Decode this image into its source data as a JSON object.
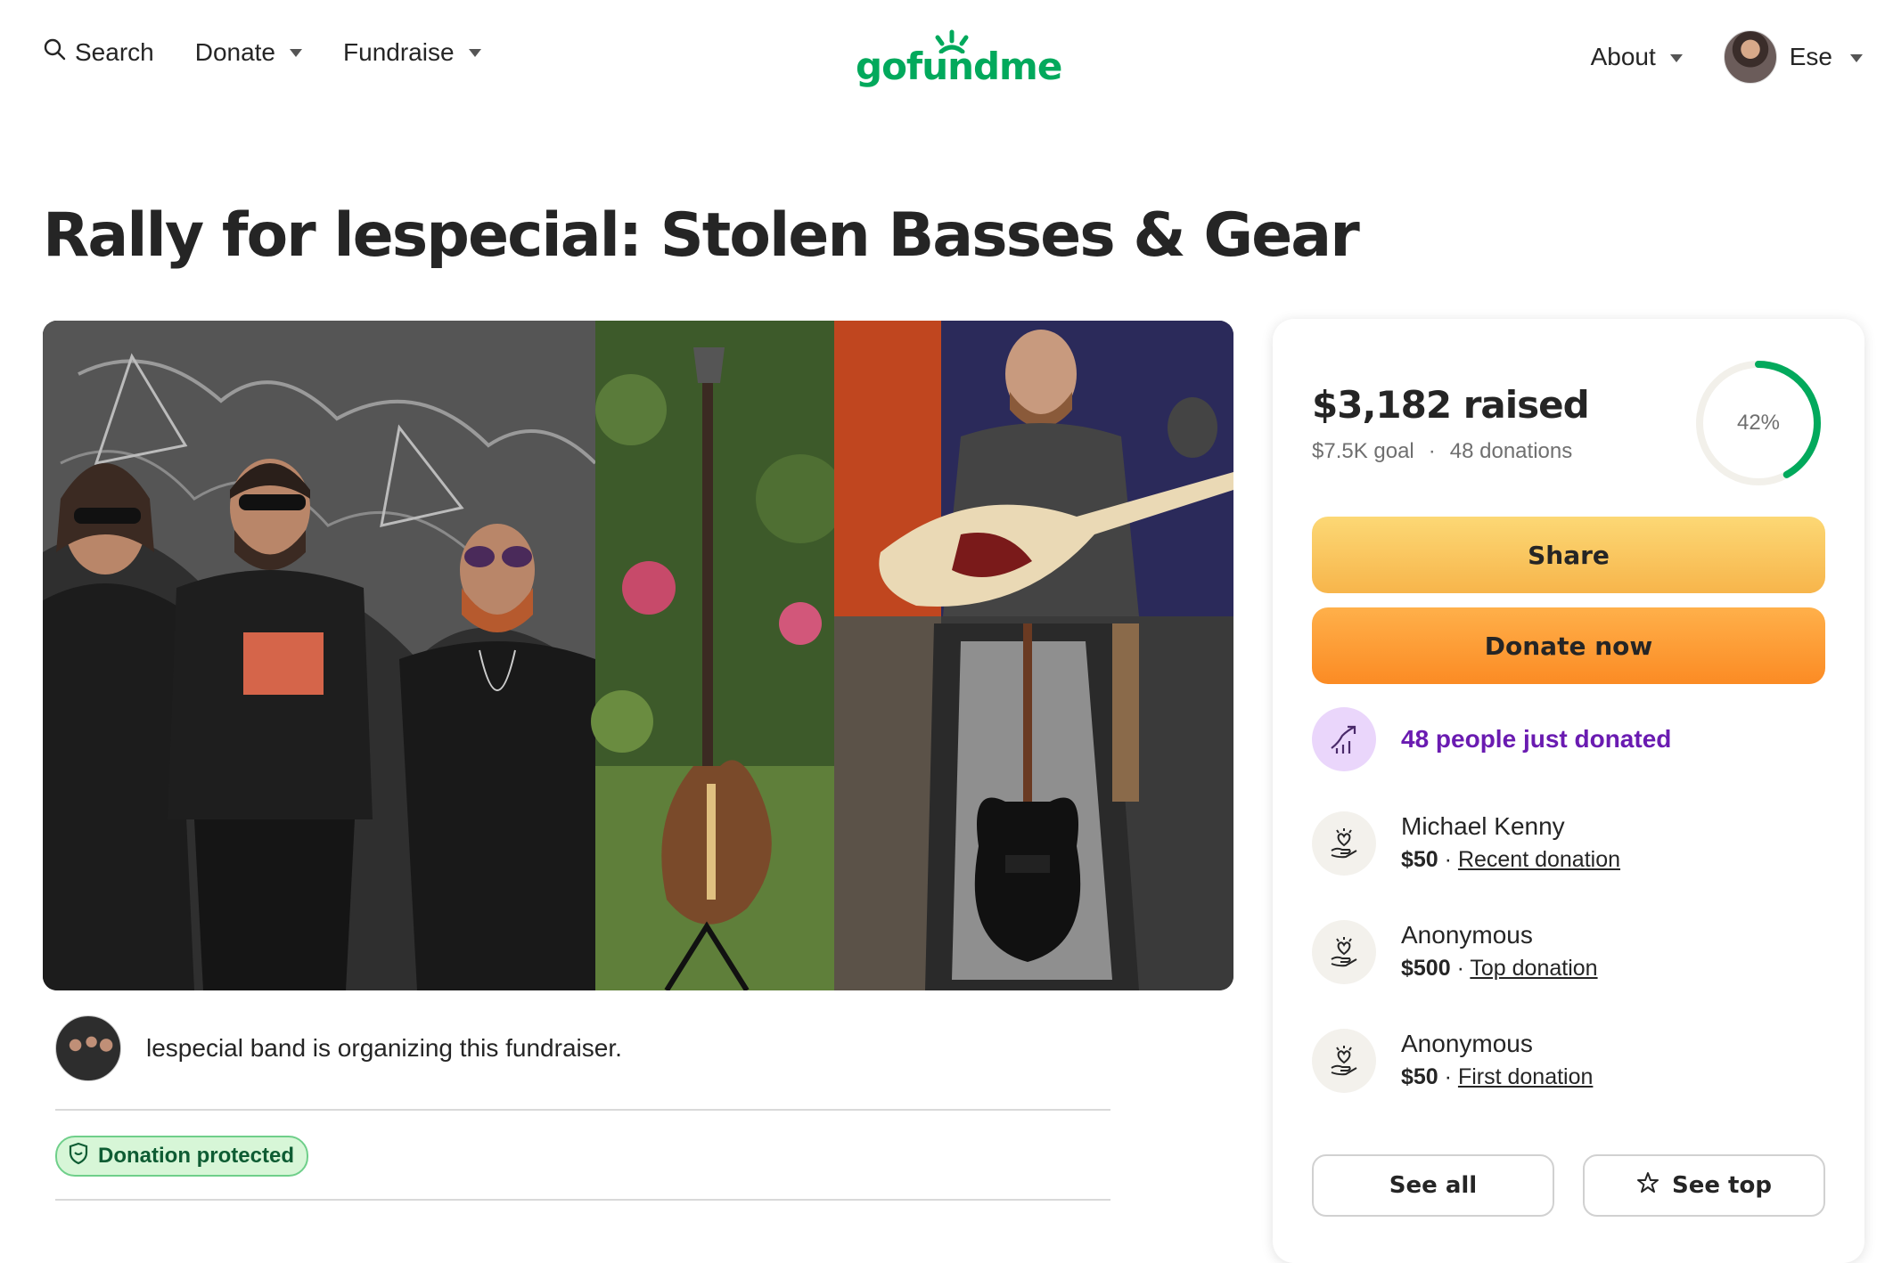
{
  "header": {
    "search_label": "Search",
    "donate_label": "Donate",
    "fundraise_label": "Fundraise",
    "logo_text": "gofundme",
    "about_label": "About",
    "user_name": "Ese"
  },
  "page": {
    "title": "Rally for lespecial: Stolen Basses & Gear"
  },
  "organizer": {
    "text": "lespecial band is organizing this fundraiser."
  },
  "badge": {
    "label": "Donation protected"
  },
  "card": {
    "raised": "$3,182 raised",
    "goal": "$7.5K goal",
    "separator": "·",
    "donations_count": "48 donations",
    "progress_label": "42%",
    "progress_fraction": 0.42,
    "share_label": "Share",
    "donate_now_label": "Donate now",
    "just_donated": "48 people just donated",
    "donations": [
      {
        "name": "Michael Kenny",
        "amount": "$50",
        "dot": " · ",
        "type": "Recent donation"
      },
      {
        "name": "Anonymous",
        "amount": "$500",
        "dot": " · ",
        "type": "Top donation"
      },
      {
        "name": "Anonymous",
        "amount": "$50",
        "dot": " · ",
        "type": "First donation"
      }
    ],
    "see_all_label": "See all",
    "see_top_label": "See top"
  },
  "colors": {
    "brand_green": "#02a95c",
    "share_yellow": "#f7b54b",
    "donate_orange": "#fb8b24",
    "purple_text": "#6a1bb1",
    "badge_green_bg": "#d7f6d7"
  },
  "icons": {
    "search": "search-icon",
    "caret": "chevron-down-icon",
    "trend": "trending-up-icon",
    "heart": "hand-heart-icon",
    "shield": "shield-icon",
    "star": "star-icon"
  }
}
